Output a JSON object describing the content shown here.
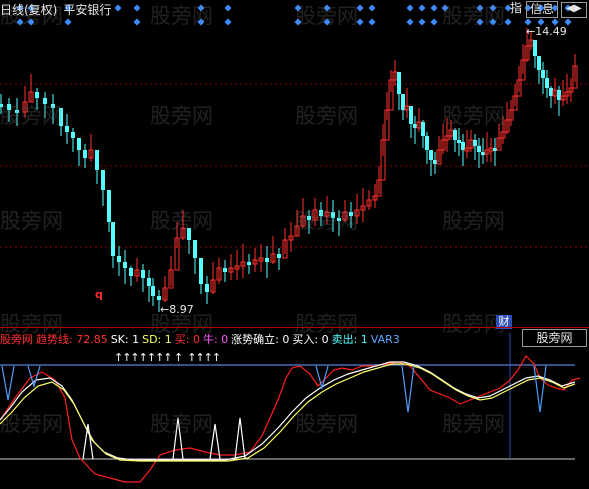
{
  "header": {
    "title": "日线(复权)",
    "stock_name": "平安银行",
    "btn_index": "指",
    "btn_info": "信息",
    "nav_arrows": "◀▶"
  },
  "main_chart": {
    "high_label": "14.49",
    "low_label": "8.97",
    "q_marker": "q",
    "cai_label": "财",
    "colors": {
      "up": "#ff3030",
      "down": "#54ffff",
      "diamond": "#3d8bff",
      "grid": "#8b0000"
    }
  },
  "indicator": {
    "name": "股旁网",
    "values": [
      {
        "label": "趋势线: 72.85",
        "color": "#ff3030"
      },
      {
        "label": "SK: 1",
        "color": "#ffffff"
      },
      {
        "label": "SD: 1",
        "color": "#ffff55"
      },
      {
        "label": "买: 0",
        "color": "#ff3030"
      },
      {
        "label": "牛: 0",
        "color": "#ff55ff"
      },
      {
        "label": "涨势确立: 0",
        "color": "#ffffff"
      },
      {
        "label": "买入: 0",
        "color": "#ffffff"
      },
      {
        "label": "卖出: 1",
        "color": "#54ffff"
      },
      {
        "label": "VAR3",
        "color": "#5fa8ff"
      }
    ],
    "selector": "股旁网",
    "buy_arrows": "↑↑↑↑↑↑↑ ↑  ↑↑↑↑"
  },
  "watermark": "股旁网"
}
